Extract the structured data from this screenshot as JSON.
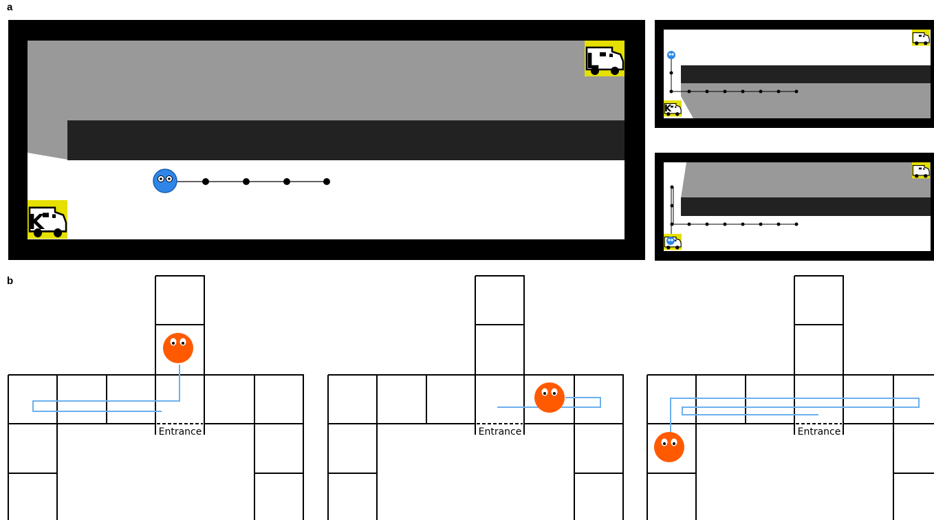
{
  "panel_a_label": "a",
  "panel_b_label": "b",
  "truck_k": "K",
  "truck_l": "L",
  "entrance_label": "Entrance",
  "colors": {
    "agent_blue": "#2f86e8",
    "agent_orange": "#ff5a00",
    "path_blue": "#6ab0ee",
    "truck_yellow": "#e5e000",
    "wall_dark": "#222222",
    "shadow_gray": "#999999"
  },
  "icons": [
    "blue-agent-icon",
    "orange-agent-icon",
    "food-truck-k-icon",
    "food-truck-l-icon"
  ]
}
